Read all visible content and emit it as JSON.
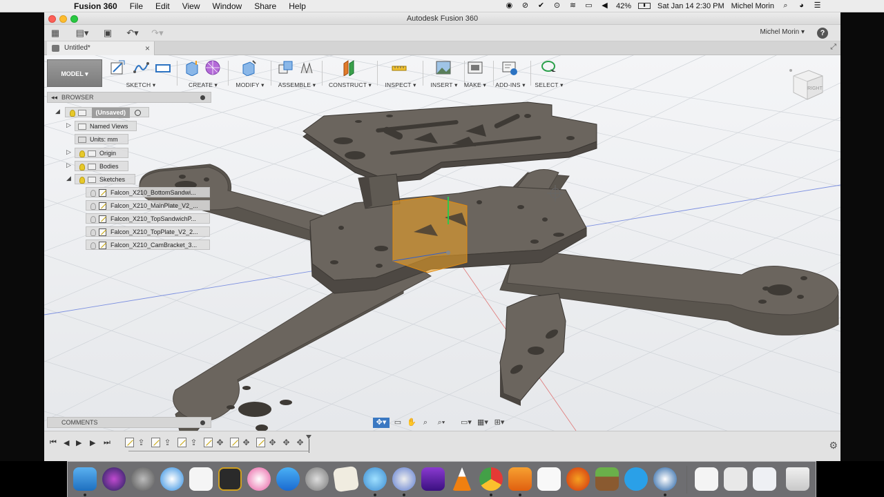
{
  "menubar": {
    "app_name": "Fusion 360",
    "items": [
      "File",
      "Edit",
      "View",
      "Window",
      "Share",
      "Help"
    ],
    "battery": "42%",
    "datetime": "Sat Jan 14  2:30 PM",
    "user": "Michel Morin"
  },
  "window": {
    "title": "Autodesk Fusion 360",
    "user_menu": "Michel Morin",
    "help": "?",
    "document_tab": "Untitled*"
  },
  "toolbar": {
    "mode": "MODEL",
    "groups": [
      {
        "label": "SKETCH"
      },
      {
        "label": "CREATE"
      },
      {
        "label": "MODIFY"
      },
      {
        "label": "ASSEMBLE"
      },
      {
        "label": "CONSTRUCT"
      },
      {
        "label": "INSPECT"
      },
      {
        "label": "INSERT"
      },
      {
        "label": "MAKE"
      },
      {
        "label": "ADD-INS"
      },
      {
        "label": "SELECT"
      }
    ]
  },
  "viewcube": {
    "face": "RIGHT"
  },
  "browser": {
    "title": "BROWSER",
    "root": "(Unsaved)",
    "named_views": "Named Views",
    "units": "Units: mm",
    "origin": "Origin",
    "bodies": "Bodies",
    "sketches": "Sketches",
    "sketch_items": [
      "Falcon_X210_BottomSandwi...",
      "Falcon_X210_MainPlate_V2_...",
      "Falcon_X210_TopSandwichP...",
      "Falcon_X210_TopPlate_V2_2...",
      "Falcon_X210_CamBracket_3..."
    ]
  },
  "comments": {
    "title": "COMMENTS"
  },
  "colors": {
    "part_fill": "#6b655e",
    "part_edge": "#4a4540",
    "grid": "#cfd3d8",
    "selection": "#f5a623",
    "accent_blue": "#1e6fbf"
  }
}
